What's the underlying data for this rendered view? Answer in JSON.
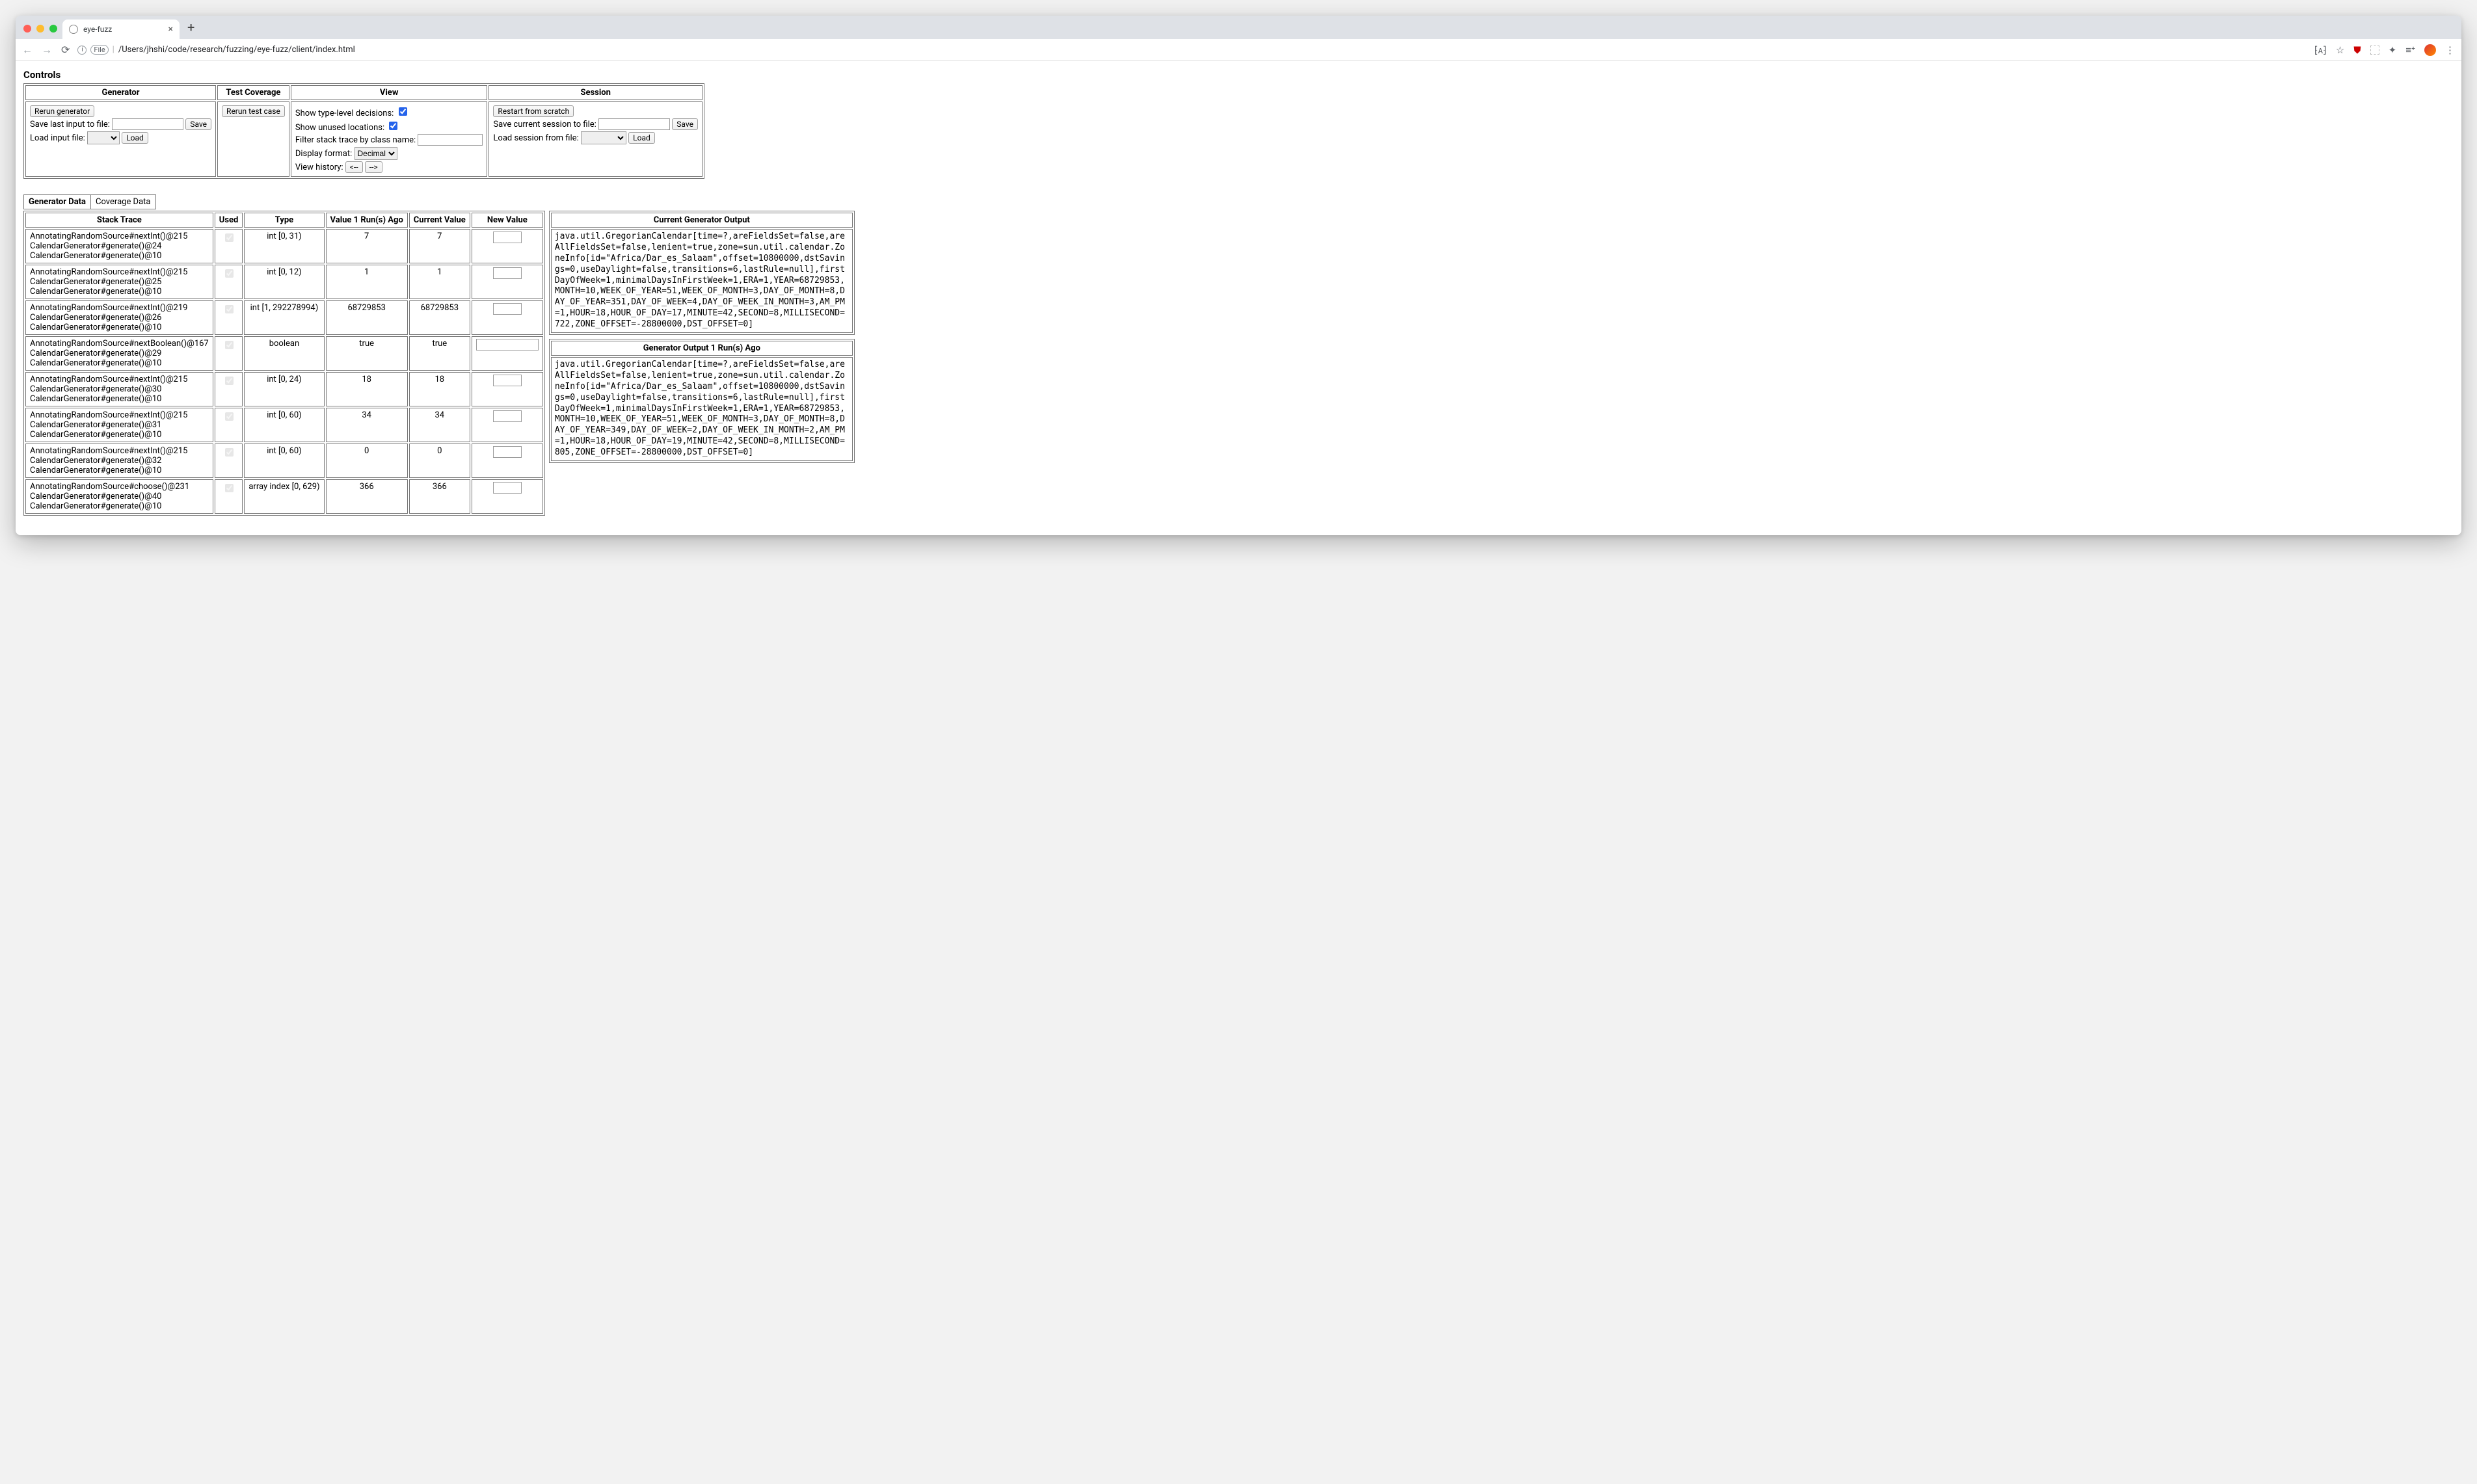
{
  "browser": {
    "tab_title": "eye-fuzz",
    "url_prefix_label": "File",
    "url_path": "/Users/jhshi/code/research/fuzzing/eye-fuzz/client/index.html"
  },
  "controls_heading": "Controls",
  "controls": {
    "generator": {
      "header": "Generator",
      "rerun_btn": "Rerun generator",
      "save_label": "Save last input to file:",
      "save_btn": "Save",
      "load_label": "Load input file:",
      "load_btn": "Load"
    },
    "test_coverage": {
      "header": "Test Coverage",
      "rerun_btn": "Rerun test case"
    },
    "view": {
      "header": "View",
      "show_type_level": "Show type-level decisions:",
      "show_type_level_checked": true,
      "show_unused": "Show unused locations:",
      "show_unused_checked": true,
      "filter_label": "Filter stack trace by class name:",
      "display_format_label": "Display format:",
      "display_format_value": "Decimal",
      "history_label": "View history:",
      "history_back": "<--",
      "history_fwd": "-->"
    },
    "session": {
      "header": "Session",
      "restart_btn": "Restart from scratch",
      "save_label": "Save current session to file:",
      "save_btn": "Save",
      "load_label": "Load session from file:",
      "load_btn": "Load"
    }
  },
  "tabs": {
    "generator_data": "Generator Data",
    "coverage_data": "Coverage Data"
  },
  "gen_table": {
    "headers": {
      "stack": "Stack Trace",
      "used": "Used",
      "type": "Type",
      "val1": "Value 1 Run(s) Ago",
      "cur": "Current Value",
      "newv": "New Value"
    },
    "rows": [
      {
        "stack": [
          "AnnotatingRandomSource#nextInt()@215",
          "CalendarGenerator#generate()@24",
          "CalendarGenerator#generate()@10"
        ],
        "used": true,
        "type": "int [0, 31)",
        "v1": "7",
        "cur": "7"
      },
      {
        "stack": [
          "AnnotatingRandomSource#nextInt()@215",
          "CalendarGenerator#generate()@25",
          "CalendarGenerator#generate()@10"
        ],
        "used": true,
        "type": "int [0, 12)",
        "v1": "1",
        "cur": "1"
      },
      {
        "stack": [
          "AnnotatingRandomSource#nextInt()@219",
          "CalendarGenerator#generate()@26",
          "CalendarGenerator#generate()@10"
        ],
        "used": true,
        "type": "int [1, 292278994)",
        "v1": "68729853",
        "cur": "68729853"
      },
      {
        "stack": [
          "AnnotatingRandomSource#nextBoolean()@167",
          "CalendarGenerator#generate()@29",
          "CalendarGenerator#generate()@10"
        ],
        "used": true,
        "type": "boolean",
        "v1": "true",
        "cur": "true",
        "wide": true
      },
      {
        "stack": [
          "AnnotatingRandomSource#nextInt()@215",
          "CalendarGenerator#generate()@30",
          "CalendarGenerator#generate()@10"
        ],
        "used": true,
        "type": "int [0, 24)",
        "v1": "18",
        "cur": "18"
      },
      {
        "stack": [
          "AnnotatingRandomSource#nextInt()@215",
          "CalendarGenerator#generate()@31",
          "CalendarGenerator#generate()@10"
        ],
        "used": true,
        "type": "int [0, 60)",
        "v1": "34",
        "cur": "34"
      },
      {
        "stack": [
          "AnnotatingRandomSource#nextInt()@215",
          "CalendarGenerator#generate()@32",
          "CalendarGenerator#generate()@10"
        ],
        "used": true,
        "type": "int [0, 60)",
        "v1": "0",
        "cur": "0"
      },
      {
        "stack": [
          "AnnotatingRandomSource#choose()@231",
          "CalendarGenerator#generate()@40",
          "CalendarGenerator#generate()@10"
        ],
        "used": true,
        "type": "array index [0, 629)",
        "v1": "366",
        "cur": "366"
      }
    ]
  },
  "outputs": {
    "current_header": "Current Generator Output",
    "current_text": "java.util.GregorianCalendar[time=?,areFieldsSet=false,areAllFieldsSet=false,lenient=true,zone=sun.util.calendar.ZoneInfo[id=\"Africa/Dar_es_Salaam\",offset=10800000,dstSavings=0,useDaylight=false,transitions=6,lastRule=null],firstDayOfWeek=1,minimalDaysInFirstWeek=1,ERA=1,YEAR=68729853,MONTH=10,WEEK_OF_YEAR=51,WEEK_OF_MONTH=3,DAY_OF_MONTH=8,DAY_OF_YEAR=351,DAY_OF_WEEK=4,DAY_OF_WEEK_IN_MONTH=3,AM_PM=1,HOUR=18,HOUR_OF_DAY=17,MINUTE=42,SECOND=8,MILLISECOND=722,ZONE_OFFSET=-28800000,DST_OFFSET=0]",
    "prev_header": "Generator Output 1 Run(s) Ago",
    "prev_text": "java.util.GregorianCalendar[time=?,areFieldsSet=false,areAllFieldsSet=false,lenient=true,zone=sun.util.calendar.ZoneInfo[id=\"Africa/Dar_es_Salaam\",offset=10800000,dstSavings=0,useDaylight=false,transitions=6,lastRule=null],firstDayOfWeek=1,minimalDaysInFirstWeek=1,ERA=1,YEAR=68729853,MONTH=10,WEEK_OF_YEAR=51,WEEK_OF_MONTH=3,DAY_OF_MONTH=8,DAY_OF_YEAR=349,DAY_OF_WEEK=2,DAY_OF_WEEK_IN_MONTH=2,AM_PM=1,HOUR=18,HOUR_OF_DAY=19,MINUTE=42,SECOND=8,MILLISECOND=805,ZONE_OFFSET=-28800000,DST_OFFSET=0]"
  }
}
